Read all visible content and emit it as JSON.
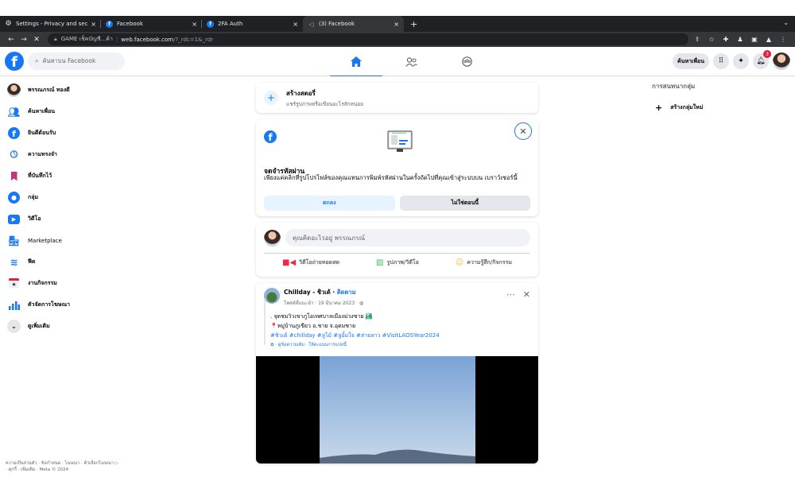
{
  "browser": {
    "tabs": [
      {
        "icon": "gear",
        "label": "Settings - Privacy and securit",
        "active": false
      },
      {
        "icon": "fb",
        "label": "Facebook",
        "active": false
      },
      {
        "icon": "fb",
        "label": "2FA Auth",
        "active": false
      },
      {
        "icon": "sound",
        "label": "(3) Facebook",
        "active": true
      }
    ],
    "new_tab": "+",
    "address": {
      "site_label": "GAME เช็คบัญชี...ค้า",
      "host": "web.facebook.com",
      "path": "/?_rdc=1&_rdr"
    }
  },
  "header": {
    "search_placeholder": "ค้นหาบน Facebook",
    "find_friends": "ค้นหาเพื่อน",
    "notif_count": "3"
  },
  "sidebar": {
    "items": [
      {
        "icon": "profile",
        "label": "พรรณภรณ์ ทองดี"
      },
      {
        "icon": "friends",
        "label": "ค้นหาเพื่อน"
      },
      {
        "icon": "welcome",
        "label": "ยินดีต้อนรับ"
      },
      {
        "icon": "memories",
        "label": "ความทรงจำ"
      },
      {
        "icon": "saved",
        "label": "ที่บันทึกไว้"
      },
      {
        "icon": "groups",
        "label": "กลุ่ม"
      },
      {
        "icon": "video",
        "label": "วิดีโอ"
      },
      {
        "icon": "marketplace",
        "label": "Marketplace"
      },
      {
        "icon": "feeds",
        "label": "ฟีด"
      },
      {
        "icon": "events",
        "label": "งานกิจกรรม"
      },
      {
        "icon": "ads",
        "label": "ตัวจัดการโฆษณา"
      },
      {
        "icon": "more",
        "label": "ดูเพิ่มเติม"
      }
    ],
    "footer_line1": "ความเป็นส่วนตัว · ข้อกำหนด · โฆษณา · ตัวเลือกโฆษณา ▷",
    "footer_line2": "· คุกกี้ · เพิ่มเติม · Meta © 2024"
  },
  "story": {
    "title": "สร้างสตอรี่",
    "subtitle": "แชร์รูปภาพหรือเขียนอะไรสักหน่อย"
  },
  "password_prompt": {
    "title": "จดจำรหัสผ่าน",
    "description": "เพียงแค่คลิกที่รูปโปรไฟล์ของคุณแทนการพิมพ์รหัสผ่านในครั้งถัดไปที่คุณเข้าสู่ระบบบน เบราว์เซอร์นี้",
    "ok_label": "ตกลง",
    "not_now_label": "ไม่ใช่ตอนนี้"
  },
  "composer": {
    "placeholder": "คุณคิดอะไรอยู่ พรรณภรณ์",
    "live_label": "วิดีโอถ่ายทอดสด",
    "photo_label": "รูปภาพ/วิดีโอ",
    "feeling_label": "ความรู้สึก/กิจกรรม"
  },
  "post": {
    "author": "Chillday - ชิวเด้",
    "follow": "ติดตาม",
    "meta": "โพสต์ที่แนะนำ · 19 มีนาคม 2023 · ◍",
    "line1": ". จุดชมวิวเขาภูโอเทศบาลเมืองม่วงชาย 🏞️",
    "line2": "📍หมู่บ้านภูเขียว อ.ชาย จ.อุดมชาย",
    "tags": "#ชิวเด้ #chillday #ลูไม้ #ลูอิ้มใจ #ส่ายลาว #VisitLAOSYear2024",
    "see_translation": "✿ · ดูข้อความเดิม · ให้คะแนนการแปลนี้"
  },
  "right": {
    "heading": "การสนทนากลุ่ม",
    "new_group": "สร้างกลุ่มใหม่"
  },
  "colors": {
    "fb_blue": "#1877f2",
    "browser_dark": "#202124",
    "browser_tab": "#35363a"
  }
}
